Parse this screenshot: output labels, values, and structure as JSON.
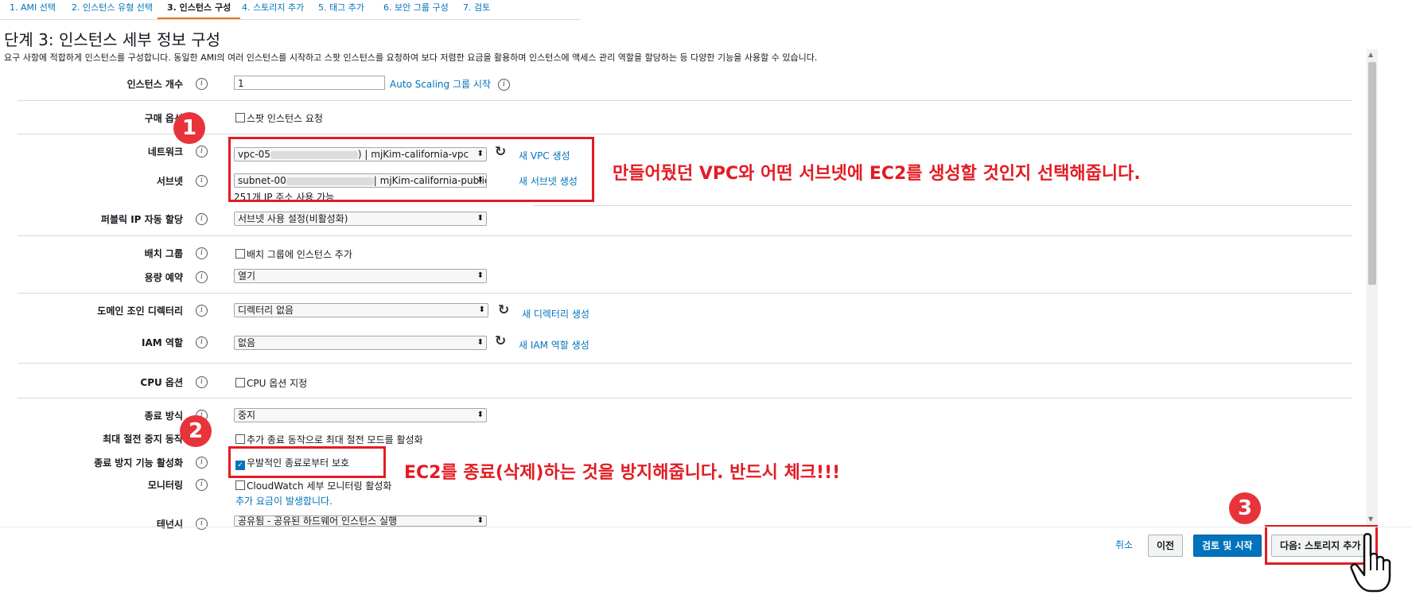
{
  "wizard": {
    "steps": [
      "1. AMI 선택",
      "2. 인스턴스 유형 선택",
      "3. 인스턴스 구성",
      "4. 스토리지 추가",
      "5. 태그 추가",
      "6. 보안 그룹 구성",
      "7. 검토"
    ]
  },
  "page": {
    "title": "단계 3: 인스턴스 세부 정보 구성",
    "description": "요구 사항에 적합하게 인스턴스를 구성합니다. 동일한 AMI의 여러 인스턴스를 시작하고 스팟 인스턴스를 요청하여 보다 저렴한 요금을 활용하며 인스턴스에 액세스 관리 역할을 할당하는 등 다양한 기능을 사용할 수 있습니다."
  },
  "form": {
    "instance_count": {
      "label": "인스턴스 개수",
      "value": "1",
      "link": "Auto Scaling 그룹 시작"
    },
    "purchase_option": {
      "label": "구매 옵션",
      "checkbox": "스팟 인스턴스 요청"
    },
    "network": {
      "label": "네트워크",
      "value_prefix": "vpc-05",
      "value_suffix": ") | mjKim-california-vpc",
      "link": "새 VPC 생성"
    },
    "subnet": {
      "label": "서브넷",
      "value_prefix": "subnet-00",
      "value_suffix": "| mjKim-california-public",
      "link": "새 서브넷 생성",
      "hint": "251개 IP 주소 사용 가능"
    },
    "public_ip": {
      "label": "퍼블릭 IP 자동 할당",
      "value": "서브넷 사용 설정(비활성화)"
    },
    "placement_group": {
      "label": "배치 그룹",
      "checkbox": "배치 그룹에 인스턴스 추가"
    },
    "capacity_reservation": {
      "label": "용량 예약",
      "value": "열기"
    },
    "domain_join": {
      "label": "도메인 조인 디렉터리",
      "value": "디렉터리 없음",
      "link": "새 디렉터리 생성"
    },
    "iam_role": {
      "label": "IAM 역할",
      "value": "없음",
      "link": "새 IAM 역할 생성"
    },
    "cpu_options": {
      "label": "CPU 옵션",
      "checkbox": "CPU 옵션 지정"
    },
    "shutdown_behavior": {
      "label": "종료 방식",
      "value": "중지"
    },
    "stop_hibernate": {
      "label": "최대 절전 중지 동작",
      "checkbox": "추가 종료 동작으로 최대 절전 모드를 활성화"
    },
    "termination_protection": {
      "label": "종료 방지 기능 활성화",
      "checkbox": "우발적인 종료로부터 보호",
      "checked": true
    },
    "monitoring": {
      "label": "모니터링",
      "checkbox": "CloudWatch 세부 모니터링 활성화",
      "note": "추가 요금이 발생합니다."
    },
    "tenancy": {
      "label": "테넌시",
      "value": "공유됨 - 공유된 하드웨어 인스턴스 실행"
    }
  },
  "annotations": {
    "badge1": "1",
    "badge2": "2",
    "badge3": "3",
    "note1": "만들어뒀던 VPC와 어떤 서브넷에 EC2를 생성할 것인지 선택해줍니다.",
    "note2": "EC2를 종료(삭제)하는 것을 방지해줍니다. 반드시 체크!!!",
    "color": "#e31b23"
  },
  "footer": {
    "cancel": "취소",
    "previous": "이전",
    "review_launch": "검토 및 시작",
    "next": "다음: 스토리지 추가"
  },
  "icons": {
    "info": "i",
    "dropdown": "⬍",
    "refresh": "↻",
    "check": "✓"
  },
  "colors": {
    "link": "#0073bb",
    "primary_button": "#0073bb",
    "active_step": "#ec7211"
  }
}
